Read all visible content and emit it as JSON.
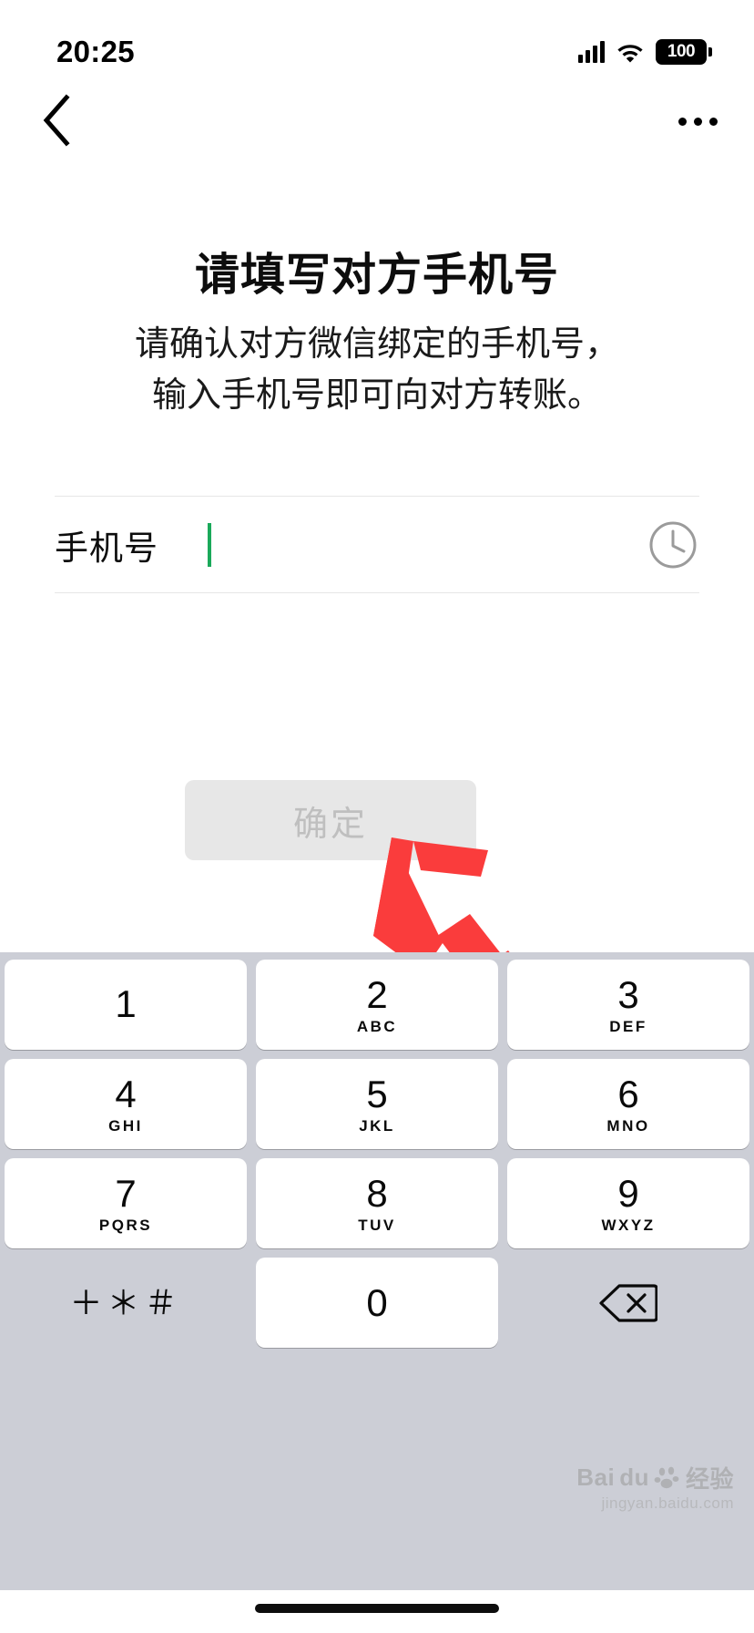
{
  "status_bar": {
    "time": "20:25",
    "signal_icon": "signal-bars-icon",
    "wifi_icon": "wifi-icon",
    "battery_level": "100",
    "battery_icon": "battery-full-icon"
  },
  "nav_bar": {
    "back_icon": "chevron-left-icon",
    "more_icon": "more-options-icon"
  },
  "content": {
    "title": "请填写对方手机号",
    "subtitle_line1": "请确认对方微信绑定的手机号，",
    "subtitle_line2": "输入手机号即可向对方转账。",
    "field": {
      "label": "手机号",
      "value": "",
      "placeholder": "",
      "history_icon": "clock-history-icon"
    },
    "confirm_button": {
      "label": "确定",
      "enabled": false,
      "bg_color": "#e7e7e7",
      "text_color": "#bfbfbf"
    },
    "annotation": {
      "type": "arrow",
      "color": "#fa3c3c",
      "points_to": "confirm-button"
    },
    "caret_color": "#1aa95a"
  },
  "keyboard": {
    "type": "numeric-phone-pad",
    "background_color": "#ccced6",
    "key_color": "#ffffff",
    "rows": [
      [
        {
          "digit": "1",
          "letters": ""
        },
        {
          "digit": "2",
          "letters": "ABC"
        },
        {
          "digit": "3",
          "letters": "DEF"
        }
      ],
      [
        {
          "digit": "4",
          "letters": "GHI"
        },
        {
          "digit": "5",
          "letters": "JKL"
        },
        {
          "digit": "6",
          "letters": "MNO"
        }
      ],
      [
        {
          "digit": "7",
          "letters": "PQRS"
        },
        {
          "digit": "8",
          "letters": "TUV"
        },
        {
          "digit": "9",
          "letters": "WXYZ"
        }
      ]
    ],
    "bottom_row": {
      "symbols_key": "＋＊＃",
      "zero_key": "0",
      "backspace_icon": "backspace-delete-icon"
    }
  },
  "watermark": {
    "brand": "Bai",
    "brand_suffix": "du",
    "label": "经验",
    "domain": "jingyan.baidu.com",
    "paw_icon": "baidu-paw-icon"
  }
}
